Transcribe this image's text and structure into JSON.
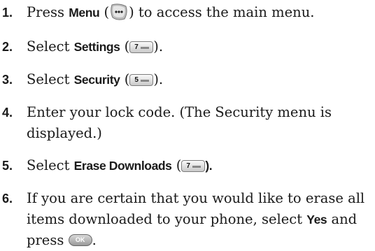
{
  "steps": [
    {
      "num": "1.",
      "pre": "Press ",
      "kw": "Menu",
      "open": " (",
      "close": ") to access the main menu."
    },
    {
      "num": "2.",
      "pre": "Select ",
      "kw": "Settings",
      "open": " (",
      "key": "7",
      "close": ")."
    },
    {
      "num": "3.",
      "pre": "Select ",
      "kw": "Security",
      "open": " (",
      "key": "5",
      "close": ")."
    },
    {
      "num": "4.",
      "line1": "Enter your lock code. (The Security menu is",
      "line2": "displayed.)"
    },
    {
      "num": "5.",
      "pre": "Select ",
      "kw": "Erase Downloads",
      "open": " (",
      "key": "7",
      "close": ")."
    },
    {
      "num": "6.",
      "line1": "If you are certain that you would like to erase all",
      "line2_pre": "items downloaded to your phone, select ",
      "line2_kw": "Yes",
      "line2_post": " and",
      "line3_pre": "press ",
      "ok": "OK",
      "line3_post": "."
    }
  ]
}
